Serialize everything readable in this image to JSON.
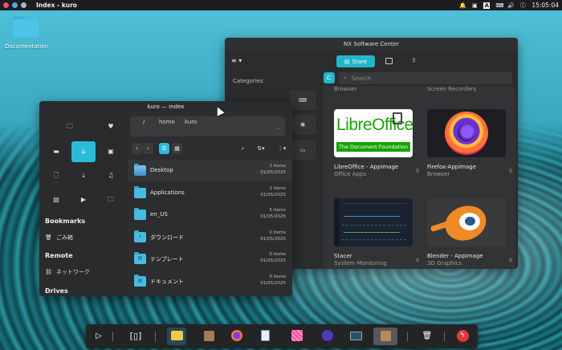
{
  "topbar": {
    "title": "Index - kuro",
    "clock": "15:05:04",
    "dot_colors": [
      "#e94c7d",
      "#5aa9e6",
      "#b0b8c4"
    ],
    "tray_icons": [
      "bell-icon",
      "lock-icon",
      "font-icon",
      "keyboard-icon",
      "volume-icon",
      "info-icon"
    ]
  },
  "desktop": {
    "icons": [
      {
        "label": "Documentation",
        "icon": "folder-icon"
      }
    ]
  },
  "software_center": {
    "title": "NX Software Center",
    "store_label": "Store",
    "categories_label": "Categories",
    "search_placeholder": "Search",
    "cutoff_labels": [
      "Browser",
      "Screen Recorders"
    ],
    "apps": [
      {
        "name": "LibreOffice - Appimage",
        "category": "Office Apps",
        "count": "0",
        "logo_line1": "LibreOffice",
        "logo_line2": "The Document Foundation"
      },
      {
        "name": "Firefox-Appimage",
        "category": "Browser",
        "count": "0"
      },
      {
        "name": "Stacer",
        "category": "System Monitoring",
        "count": "0"
      },
      {
        "name": "Blender - Appimage",
        "category": "3D Graphics",
        "count": "0"
      }
    ]
  },
  "file_manager": {
    "title": "kuro — index",
    "path": [
      "/",
      "home",
      "kuro"
    ],
    "path_end": "..",
    "sidebar": {
      "bookmarks_label": "Bookmarks",
      "bookmarks": [
        {
          "label": "ごみ箱",
          "icon": "trash-icon"
        }
      ],
      "remote_label": "Remote",
      "remote": [
        {
          "label": "ネットワーク",
          "icon": "network-icon"
        }
      ],
      "drives_label": "Drives"
    },
    "files": [
      {
        "name": "Desktop",
        "items": "1 items",
        "date": "01/05/2025",
        "kind": "image",
        "glyph": ""
      },
      {
        "name": "Applications",
        "items": "1 items",
        "date": "01/05/2025",
        "kind": "folder",
        "glyph": ""
      },
      {
        "name": "en_US",
        "items": "5 items",
        "date": "01/05/2025",
        "kind": "folder",
        "glyph": ""
      },
      {
        "name": "ダウンロード",
        "items": "0 items",
        "date": "01/05/2025",
        "kind": "folder",
        "glyph": "↓"
      },
      {
        "name": "テンプレート",
        "items": "0 items",
        "date": "01/05/2025",
        "kind": "folder",
        "glyph": "▤"
      },
      {
        "name": "ドキュメント",
        "items": "0 items",
        "date": "01/05/2025",
        "kind": "folder",
        "glyph": "▤"
      }
    ]
  },
  "dock": {
    "items": [
      "play-icon",
      "overview-icon",
      "files-icon",
      "archive-icon",
      "firefox-icon",
      "document-viewer-icon",
      "pink-app-icon",
      "purple-app-icon",
      "terminal-icon",
      "package-icon",
      "trash-icon",
      "power-icon"
    ]
  },
  "colors": {
    "accent": "#29bcd8",
    "window_bg": "#2a2b2d"
  }
}
